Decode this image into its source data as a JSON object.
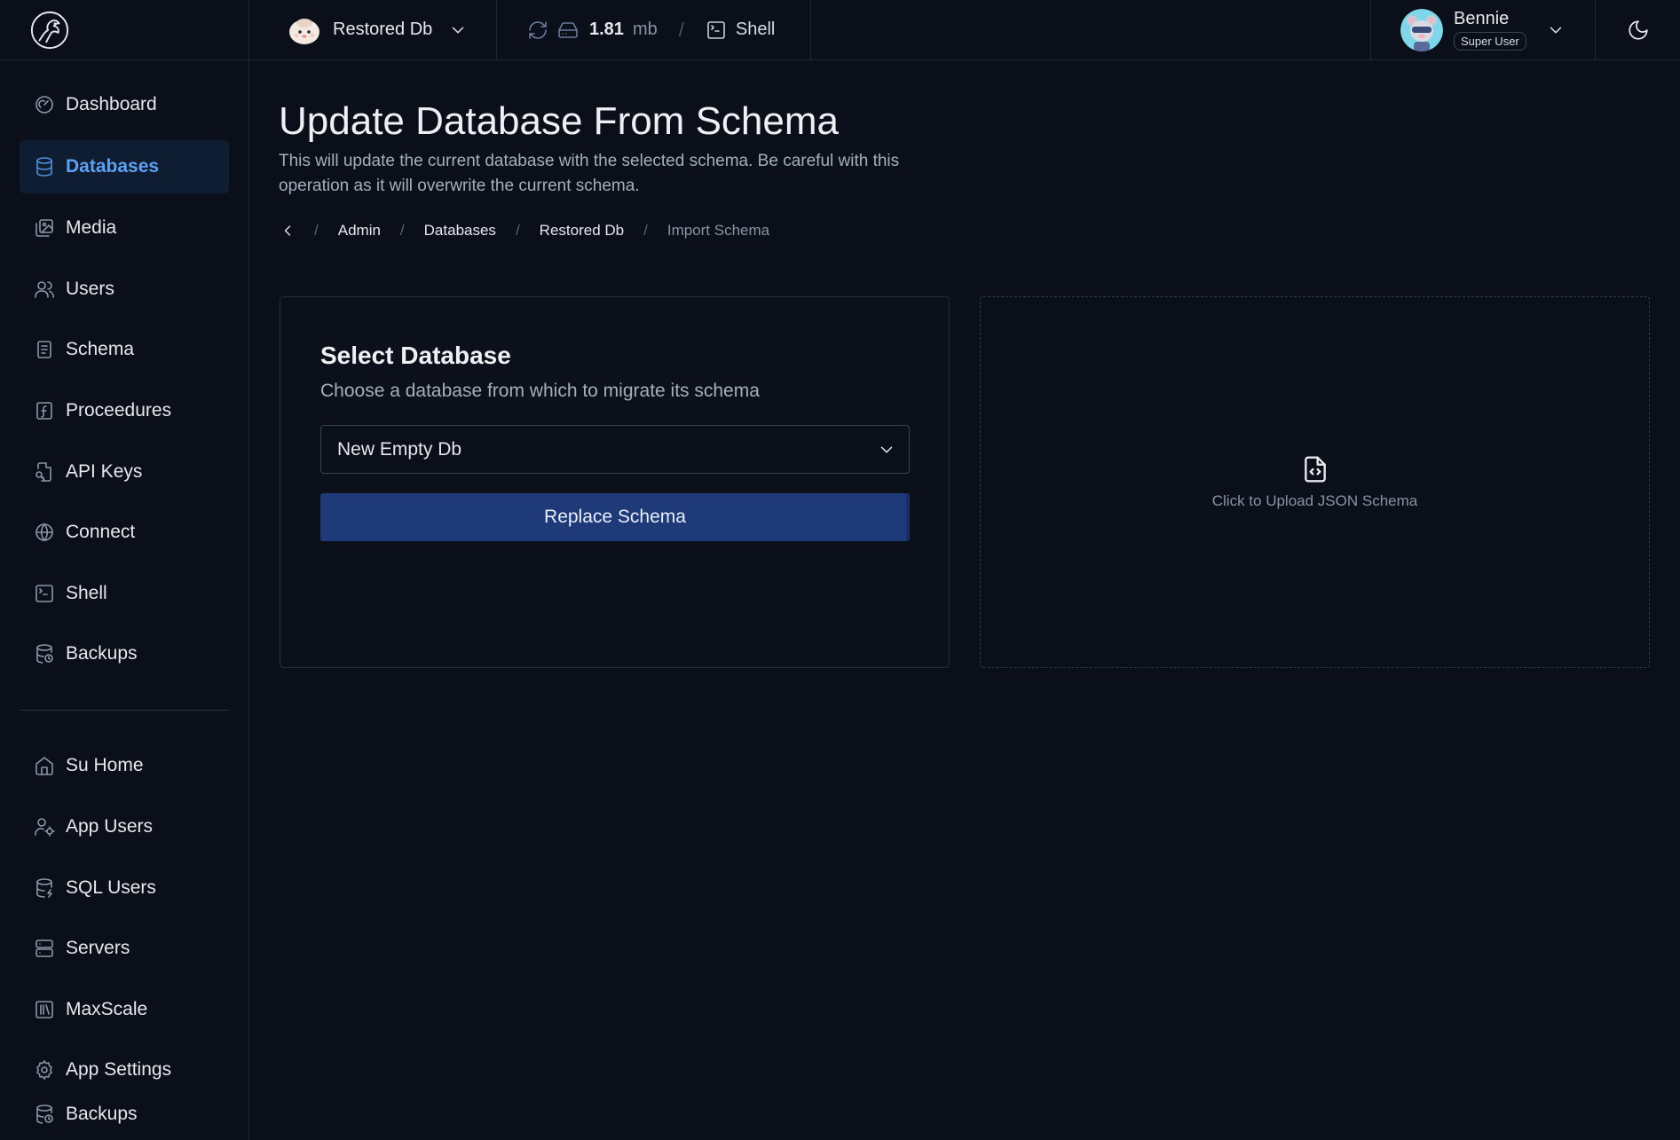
{
  "header": {
    "database_name": "Restored Db",
    "size_value": "1.81",
    "size_unit": "mb",
    "separator": "/",
    "shell_label": "Shell",
    "user_name": "Bennie",
    "user_role": "Super User"
  },
  "sidebar": {
    "primary_items": [
      {
        "label": "Dashboard",
        "icon": "gauge-icon"
      },
      {
        "label": "Databases",
        "icon": "database-icon",
        "active": true
      },
      {
        "label": "Media",
        "icon": "images-icon"
      },
      {
        "label": "Users",
        "icon": "users-icon"
      },
      {
        "label": "Schema",
        "icon": "schema-icon"
      },
      {
        "label": "Proceedures",
        "icon": "function-icon"
      },
      {
        "label": "API Keys",
        "icon": "key-file-icon"
      },
      {
        "label": "Connect",
        "icon": "globe-icon"
      },
      {
        "label": "Shell",
        "icon": "terminal-icon"
      },
      {
        "label": "Backups",
        "icon": "database-backup-icon"
      }
    ],
    "admin_items": [
      {
        "label": "Su Home",
        "icon": "home-icon"
      },
      {
        "label": "App Users",
        "icon": "user-cog-icon"
      },
      {
        "label": "SQL Users",
        "icon": "database-zap-icon"
      },
      {
        "label": "Servers",
        "icon": "server-icon"
      },
      {
        "label": "MaxScale",
        "icon": "library-icon"
      },
      {
        "label": "App Settings",
        "icon": "settings-icon"
      },
      {
        "label": "Backups",
        "icon": "database-backup-icon"
      }
    ]
  },
  "page": {
    "title": "Update Database From Schema",
    "description": "This will update the current database with the selected schema. Be careful with this operation as it will overwrite the current schema.",
    "breadcrumb": [
      "Admin",
      "Databases",
      "Restored Db",
      "Import Schema"
    ],
    "breadcrumb_separator": "/"
  },
  "select_card": {
    "title": "Select Database",
    "subtitle": "Choose a database from which to migrate its schema",
    "selected_value": "New Empty Db",
    "button_label": "Replace Schema"
  },
  "upload": {
    "label": "Click to Upload JSON Schema"
  },
  "colors": {
    "background": "#0a0f1a",
    "active_nav_bg": "#0f1d33",
    "active_nav_text": "#5ea0f2",
    "primary_button": "#1e3a78",
    "border": "#1f2633"
  }
}
